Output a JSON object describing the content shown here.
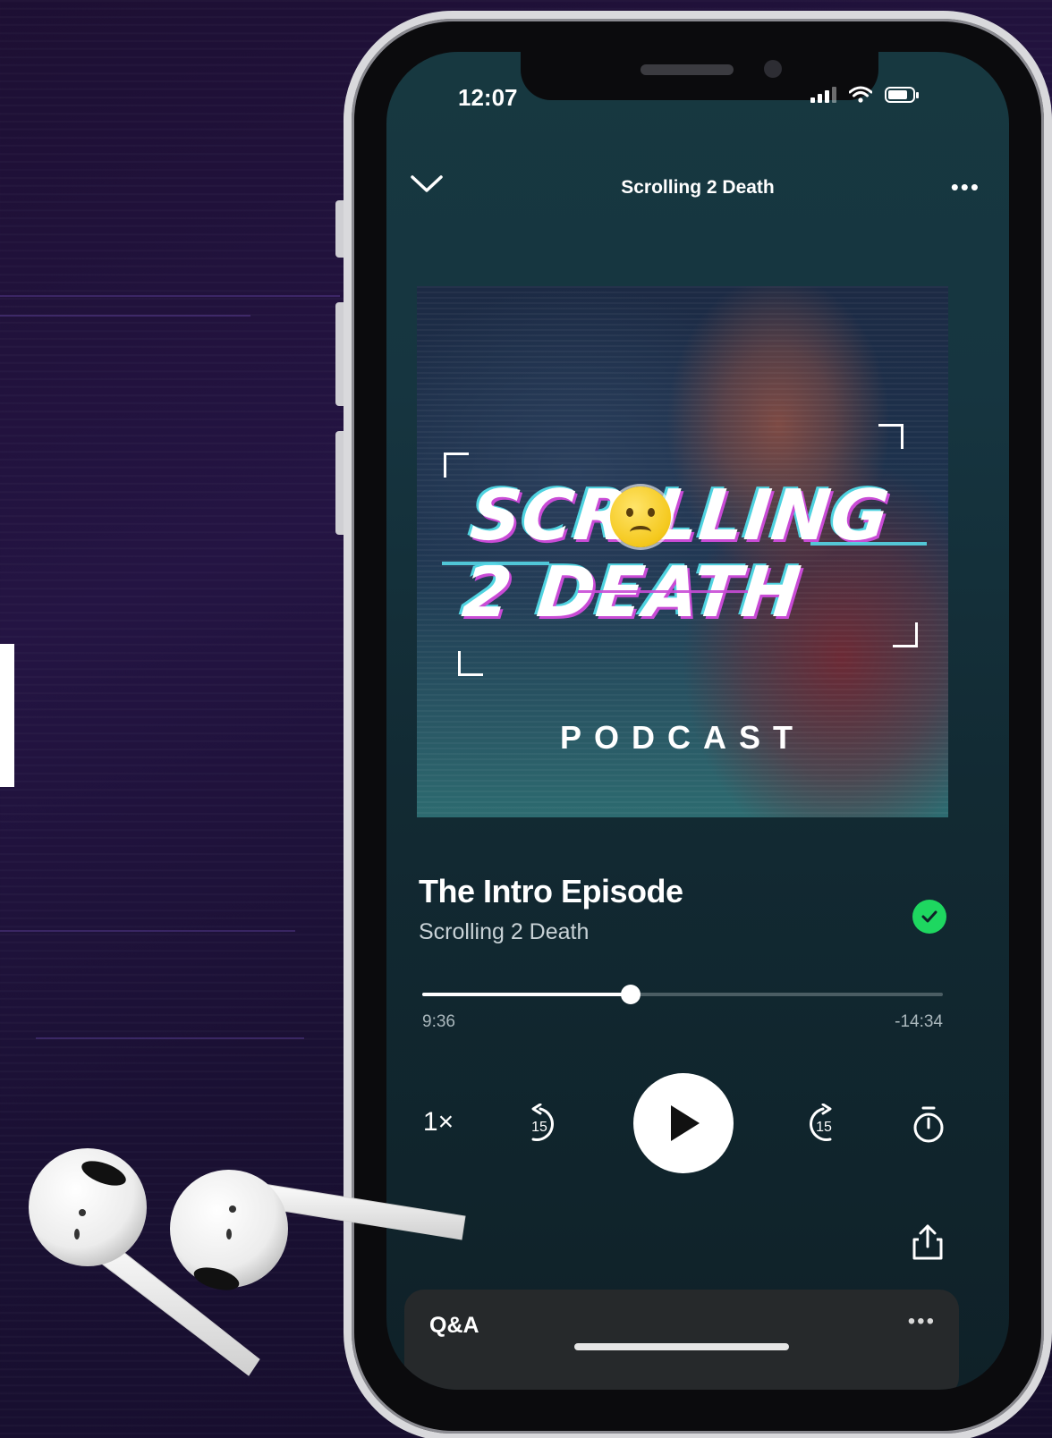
{
  "status_bar": {
    "time": "12:07"
  },
  "header": {
    "title": "Scrolling 2 Death",
    "more_label": "•••"
  },
  "artwork": {
    "title_line1": "SCR  LLING",
    "title_line2": "2 DEATH",
    "subtitle": "PODCAST"
  },
  "episode": {
    "title": "The Intro Episode",
    "show": "Scrolling 2 Death",
    "downloaded": true
  },
  "progress": {
    "elapsed": "9:36",
    "remaining": "-14:34",
    "fraction": 0.4
  },
  "controls": {
    "speed_label": "1×",
    "skip_back_seconds": "15",
    "skip_forward_seconds": "15"
  },
  "queue": {
    "label": "Q&A",
    "more_label": "•••"
  },
  "colors": {
    "accent_green": "#1ed760",
    "screen_bg": "#163540",
    "page_bg": "#1d0f33"
  }
}
